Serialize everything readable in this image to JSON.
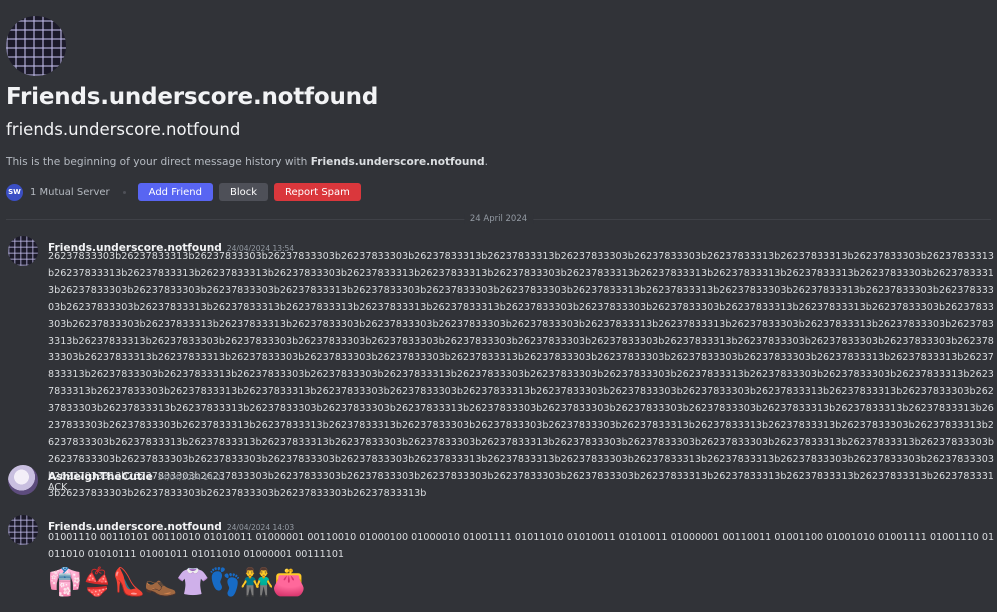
{
  "profile": {
    "display_name": "Friends.underscore.notfound",
    "username": "friends.underscore.notfound",
    "intro_prefix": "This is the beginning of your direct message history with ",
    "intro_name": "Friends.underscore.notfound",
    "intro_suffix": "."
  },
  "actions": {
    "server_icon_text": "SW",
    "mutual_servers": "1 Mutual Server",
    "add_friend": "Add Friend",
    "block": "Block",
    "report_spam": "Report Spam"
  },
  "date_divider": "24 April 2024",
  "messages": [
    {
      "author": "Friends.underscore.notfound",
      "timestamp": "24/04/2024 13:54",
      "text": "26237833303b26237833313b26237833303b26237833303b26237833303b26237833313b26237833313b26237833303b26237833303b26237833313b26237833313b26237833303b26237833313b26237833313b26237833313b26237833313b26237833303b26237833313b26237833313b26237833303b26237833313b26237833313b26237833313b26237833313b26237833303b26237833313b26237833303b26237833303b26237833303b26237833313b26237833303b26237833303b26237833303b26237833313b26237833313b26237833303b26237833313b26237833303b26237833303b26237833303b26237833313b26237833313b26237833313b26237833313b26237833313b26237833303b26237833303b26237833303b26237833313b26237833313b26237833303b26237833303b26237833303b26237833313b26237833313b26237833303b26237833303b26237833303b26237833303b26237833313b26237833313b26237833303b26237833313b26237833303b26237833313b26237833313b26237833303b26237833303b26237833303b26237833303b26237833303b26237833303b26237833303b26237833313b26237833303b26237833303b26237833303b26237833303b26237833313b26237833313b26237833303b26237833303b26237833303b26237833313b26237833303b26237833303b26237833303b26237833303b26237833313b26237833313b26237833313b26237833303b26237833313b26237833303b26237833303b26237833313b26237833303b26237833303b26237833303b26237833313b26237833303b26237833303b26237833313b26237833313b26237833303b26237833313b26237833313b26237833303b26237833303b26237833313b26237833303b26237833303b26237833303b26237833313b26237833313b26237833303b26237833303b26237833313b26237833313b26237833303b26237833303b26237833313b26237833303b26237833303b26237833303b26237833303b26237833313b26237833313b26237833313b26237833303b26237833303b26237833313b26237833313b26237833313b26237833303b26237833303b26237833303b26237833313b26237833313b26237833313b26237833303b26237833313b26237833303b26237833313b26237833313b26237833313b26237833303b26237833303b26237833313b26237833303b26237833303b26237833303b26237833313b26237833313b26237833303b26237833303b26237833303b26237833303b26237833303b26237833303b26237833313b26237833313b26237833303b26237833313b26237833313b26237833303b26237833303b26237833303b26237833313b26237833303b26237833303b26237833303b26237833303b26237833303b26237833303b26237833303b26237833313b26237833313b26237833313b26237833313b26237833313b26237833303b26237833303b26237833303b26237833303b26237833313b"
    },
    {
      "author": "AshleighTheCutie",
      "timestamp": "24/04/2024 14:01",
      "text": "ACK"
    },
    {
      "author": "Friends.underscore.notfound",
      "timestamp": "24/04/2024 14:03",
      "text": "01001110 00110101 00110010 01010011 01000001 00110010 01000100 01000010 01001111 01011010 01010011 01010011 01000001 00110011 01001100 01001010 01001111 01001110 01011010 01010111 01001011 01011010 01000001 00111101",
      "emojis": [
        "👘",
        "👙",
        "👠",
        "👞",
        "👚",
        "👣",
        "👬",
        "👛"
      ]
    }
  ]
}
